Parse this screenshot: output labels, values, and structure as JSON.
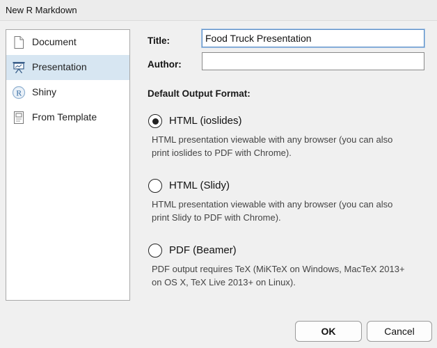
{
  "window": {
    "title": "New R Markdown"
  },
  "sidebar": {
    "items": [
      {
        "label": "Document",
        "icon": "document-icon"
      },
      {
        "label": "Presentation",
        "icon": "presentation-icon"
      },
      {
        "label": "Shiny",
        "icon": "shiny-icon"
      },
      {
        "label": "From Template",
        "icon": "template-icon"
      }
    ],
    "selected": "Presentation"
  },
  "form": {
    "title_label": "Title:",
    "title_value": "Food Truck Presentation",
    "author_label": "Author:",
    "author_value": ""
  },
  "output_format": {
    "heading": "Default Output Format:",
    "selected": "HTML (ioslides)",
    "options": [
      {
        "label": "HTML (ioslides)",
        "desc_line1": "HTML presentation viewable with any browser (you can also",
        "desc_line2": "print ioslides to PDF with Chrome)."
      },
      {
        "label": "HTML (Slidy)",
        "desc_line1": "HTML presentation viewable with any browser (you can also",
        "desc_line2": "print Slidy to PDF with Chrome)."
      },
      {
        "label": "PDF (Beamer)",
        "desc_line1": "PDF output requires TeX (MiKTeX on Windows, MacTeX 2013+",
        "desc_line2": "on OS X, TeX Live 2013+ on Linux)."
      }
    ]
  },
  "buttons": {
    "ok": "OK",
    "cancel": "Cancel"
  },
  "colors": {
    "selection": "#d7e6f2",
    "focus": "#5b8fc7"
  }
}
